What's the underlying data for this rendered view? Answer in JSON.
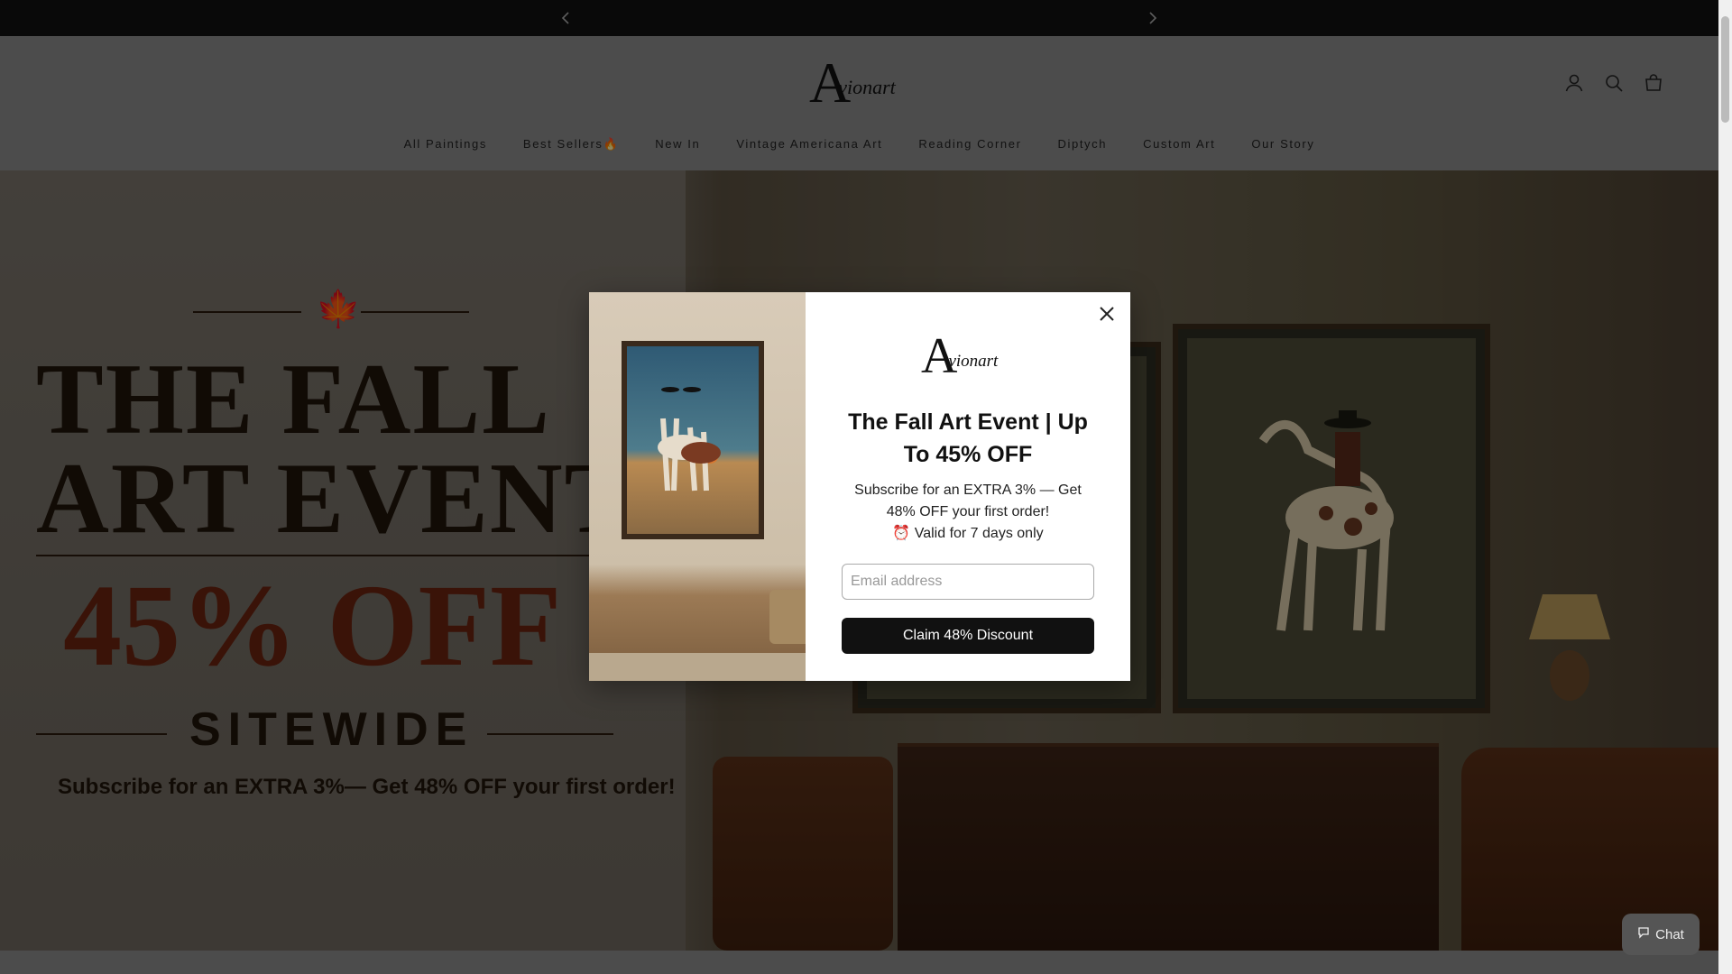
{
  "announcement": {
    "prev_icon": "chevron-left-icon",
    "next_icon": "chevron-right-icon"
  },
  "header": {
    "logo_initial": "A",
    "logo_rest": "vionart",
    "icons": [
      "account-icon",
      "search-icon",
      "cart-icon"
    ]
  },
  "nav": {
    "items": [
      {
        "label": "All Paintings"
      },
      {
        "label": "Best Sellers🔥"
      },
      {
        "label": "New In"
      },
      {
        "label": "Vintage Americana Art"
      },
      {
        "label": "Reading Corner"
      },
      {
        "label": "Diptych"
      },
      {
        "label": "Custom Art"
      },
      {
        "label": "Our Story"
      }
    ]
  },
  "hero": {
    "line1": "THE FALL",
    "line2": "ART EVENT",
    "discount": "45% OFF",
    "sitewide": "SITEWIDE",
    "subtitle": "Subscribe for an EXTRA 3%— Get 48% OFF your first order!"
  },
  "popup": {
    "logo_initial": "A",
    "logo_rest": "vionart",
    "title": "The Fall Art Event | Up To 45% OFF",
    "desc_line1": "Subscribe for an EXTRA 3% — Get",
    "desc_line2": "48% OFF your first order!",
    "desc_line3": "⏰ Valid for 7 days only",
    "email_placeholder": "Email address",
    "button_label": "Claim 48% Discount",
    "close_icon": "close-icon"
  },
  "chat": {
    "label": "Chat",
    "icon": "chat-bubble-icon"
  },
  "colors": {
    "announcement_bg": "#111111",
    "button_bg": "#111111",
    "discount_color": "#6b2410"
  }
}
